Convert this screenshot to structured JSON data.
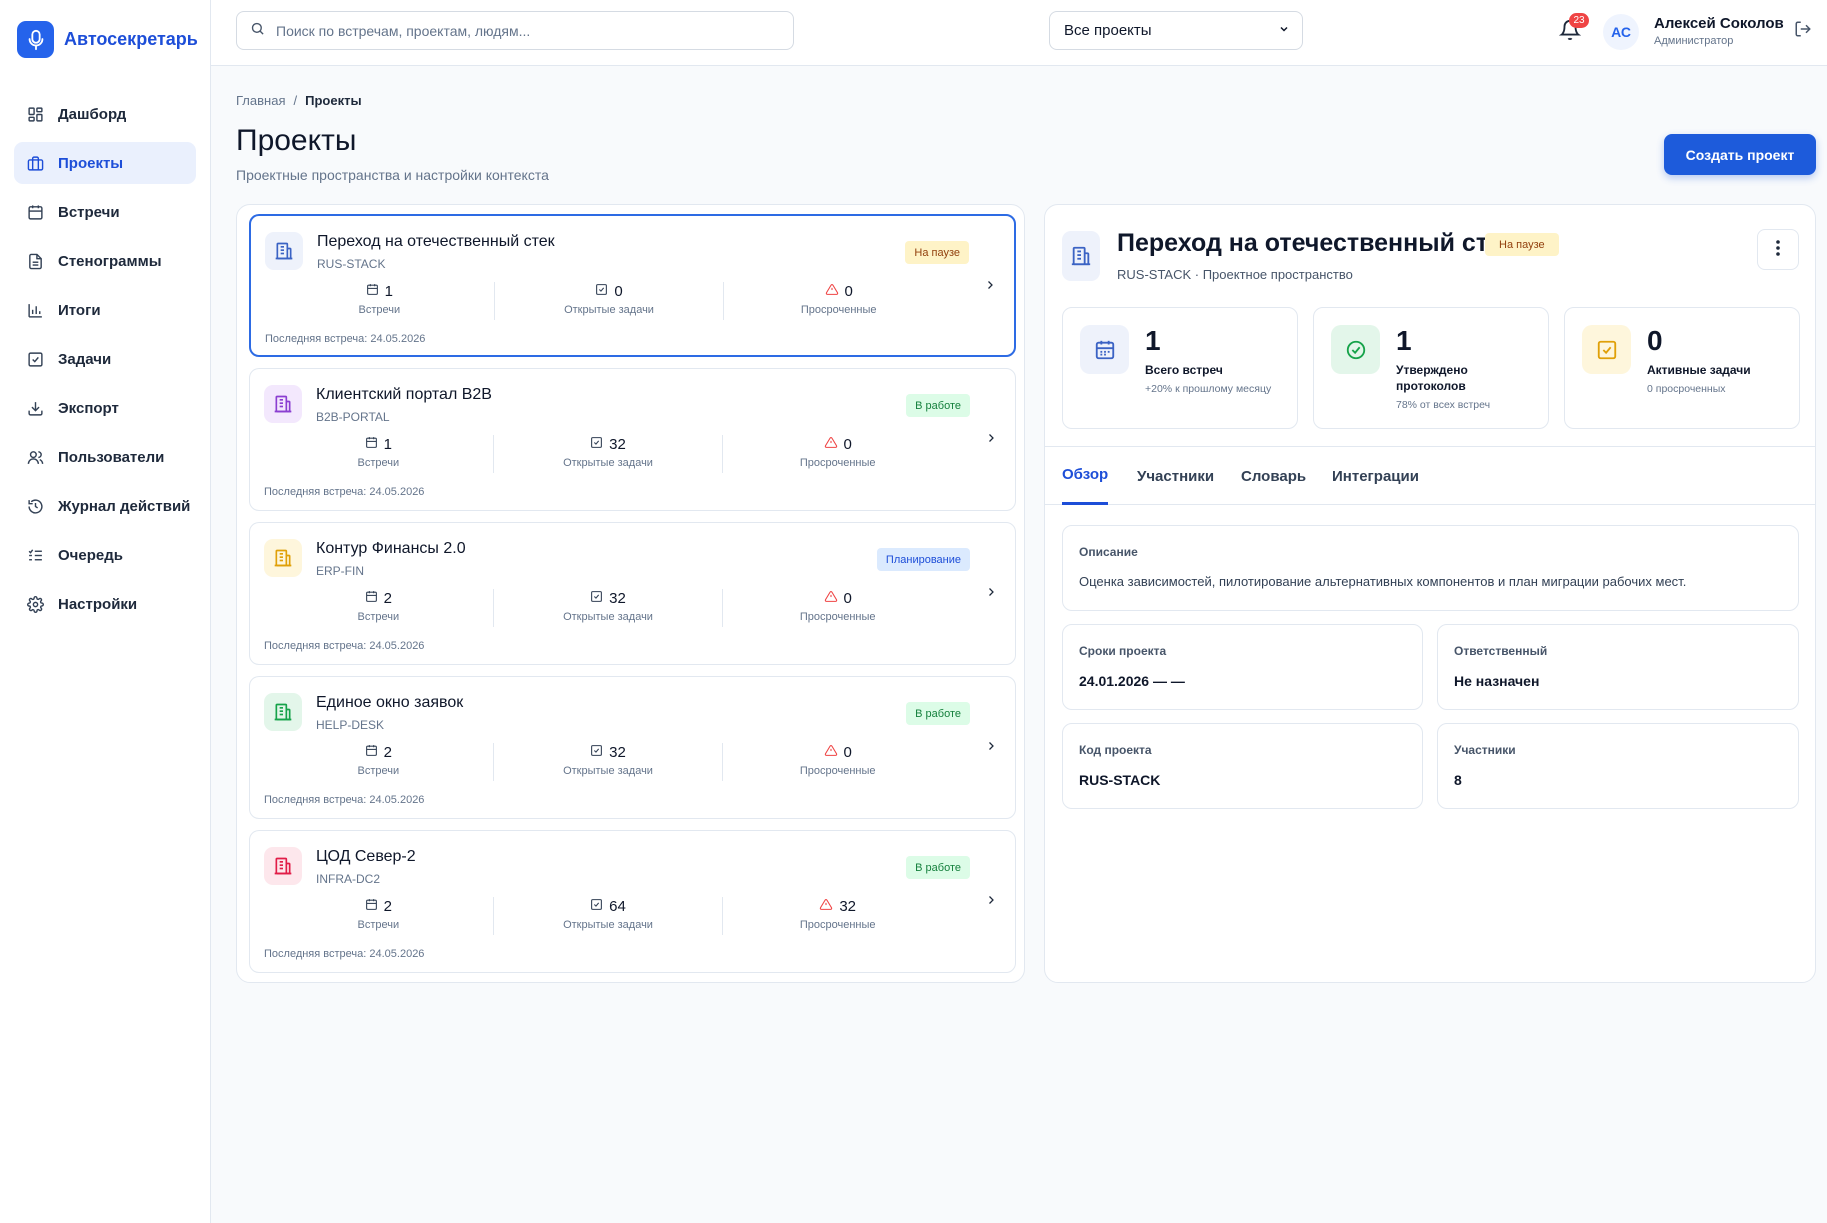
{
  "app": {
    "name": "Автосекретарь"
  },
  "sidebar": {
    "items": [
      {
        "label": "Дашборд",
        "icon": "dashboard-icon",
        "active": false
      },
      {
        "label": "Проекты",
        "icon": "briefcase-icon",
        "active": true
      },
      {
        "label": "Встречи",
        "icon": "calendar-icon",
        "active": false
      },
      {
        "label": "Стенограммы",
        "icon": "document-icon",
        "active": false
      },
      {
        "label": "Итоги",
        "icon": "bar-chart-icon",
        "active": false
      },
      {
        "label": "Задачи",
        "icon": "checkbox-icon",
        "active": false
      },
      {
        "label": "Экспорт",
        "icon": "download-icon",
        "active": false
      },
      {
        "label": "Пользователи",
        "icon": "users-icon",
        "active": false
      },
      {
        "label": "Журнал действий",
        "icon": "history-icon",
        "active": false
      },
      {
        "label": "Очередь",
        "icon": "list-check-icon",
        "active": false
      },
      {
        "label": "Настройки",
        "icon": "gear-icon",
        "active": false
      }
    ]
  },
  "header": {
    "search_placeholder": "Поиск по встречам, проектам, людям...",
    "project_filter": "Все проекты",
    "notifications_count": "23",
    "user": {
      "initials": "АС",
      "name": "Алексей Соколов",
      "role": "Администратор"
    }
  },
  "page": {
    "breadcrumb_home": "Главная",
    "breadcrumb_sep": "/",
    "breadcrumb_current": "Проекты",
    "title": "Проекты",
    "subtitle": "Проектные пространства и настройки контекста",
    "create_button": "Создать проект"
  },
  "stat_labels": {
    "meetings": "Встречи",
    "tasks": "Открытые задачи",
    "overdue": "Просроченные"
  },
  "projects": [
    {
      "name": "Переход на отечественный стек",
      "code": "RUS-STACK",
      "status": "На паузе",
      "status_kind": "pause",
      "meetings": "1",
      "tasks": "0",
      "overdue": "0",
      "last_meeting": "Последняя встреча: 24.05.2026",
      "color": "#3b63c4",
      "bg": "#eef2fb",
      "selected": true
    },
    {
      "name": "Клиентский портал B2B",
      "code": "B2B-PORTAL",
      "status": "В работе",
      "status_kind": "work",
      "meetings": "1",
      "tasks": "32",
      "overdue": "0",
      "last_meeting": "Последняя встреча: 24.05.2026",
      "color": "#8b3fd1",
      "bg": "#f3e8fd",
      "selected": false
    },
    {
      "name": "Контур Финансы 2.0",
      "code": "ERP-FIN",
      "status": "Планирование",
      "status_kind": "plan",
      "meetings": "2",
      "tasks": "32",
      "overdue": "0",
      "last_meeting": "Последняя встреча: 24.05.2026",
      "color": "#e0a008",
      "bg": "#fef6dc",
      "selected": false
    },
    {
      "name": "Единое окно заявок",
      "code": "HELP-DESK",
      "status": "В работе",
      "status_kind": "work",
      "meetings": "2",
      "tasks": "32",
      "overdue": "0",
      "last_meeting": "Последняя встреча: 24.05.2026",
      "color": "#16a34a",
      "bg": "#e3f6ea",
      "selected": false
    },
    {
      "name": "ЦОД Север-2",
      "code": "INFRA-DC2",
      "status": "В работе",
      "status_kind": "work",
      "meetings": "2",
      "tasks": "64",
      "overdue": "32",
      "last_meeting": "Последняя встреча: 24.05.2026",
      "color": "#e11d48",
      "bg": "#fde7ec",
      "selected": false
    }
  ],
  "detail": {
    "title": "Переход на отечественный стек",
    "status": "На паузе",
    "subtitle": "RUS-STACK · Проектное пространство",
    "kpis": [
      {
        "value": "1",
        "label": "Всего встреч",
        "note": "+20% к прошлому месяцу",
        "icon": "calendar-icon"
      },
      {
        "value": "1",
        "label": "Утверждено протоколов",
        "note": "78% от всех встреч",
        "icon": "check-circle-icon"
      },
      {
        "value": "0",
        "label": "Активные задачи",
        "note": "0 просроченных",
        "icon": "checkbox-icon"
      }
    ],
    "tabs": [
      "Обзор",
      "Участники",
      "Словарь",
      "Интеграции"
    ],
    "active_tab": "Обзор",
    "description_label": "Описание",
    "description": "Оценка зависимостей, пилотирование альтернативных компонентов и план миграции рабочих мест.",
    "timeline_label": "Сроки проекта",
    "timeline": "24.01.2026 — —",
    "owner_label": "Ответственный",
    "owner": "Не назначен",
    "code_label": "Код проекта",
    "code": "RUS-STACK",
    "members_label": "Участники",
    "members": "8"
  },
  "colors": {
    "accent": "#1d5bdb",
    "pause_bg": "#fef3c7",
    "work_bg": "#dcfce7",
    "plan_bg": "#dbeafe",
    "danger": "#ef4444"
  }
}
